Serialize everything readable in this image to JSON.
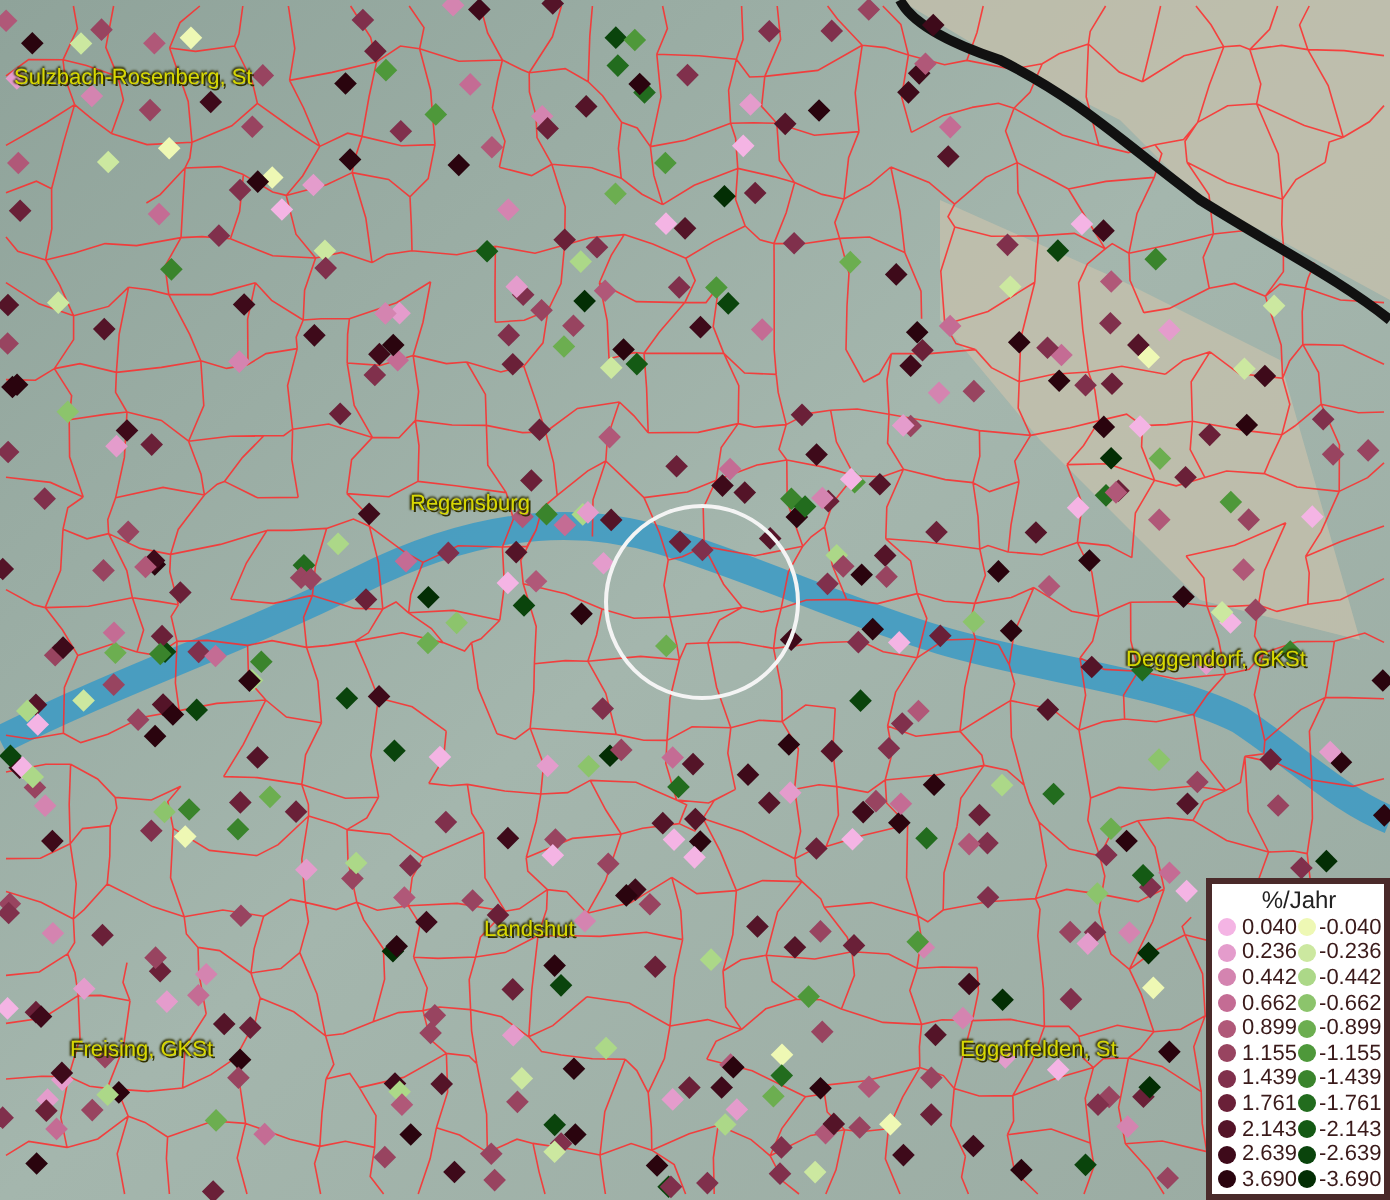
{
  "map": {
    "places": [
      {
        "name": "Sulzbach-Rosenberg, St"
      },
      {
        "name": "Regensburg"
      },
      {
        "name": "Deggendorf, GKSt"
      },
      {
        "name": "Landshut"
      },
      {
        "name": "Freising, GKSt"
      },
      {
        "name": "Eggenfelden, St"
      }
    ]
  },
  "legend": {
    "title": "%/Jahr",
    "positive": [
      {
        "label": "0.040",
        "color": "#f4b4e4"
      },
      {
        "label": "0.236",
        "color": "#e49ccc"
      },
      {
        "label": "0.442",
        "color": "#d484b0"
      },
      {
        "label": "0.662",
        "color": "#c46c94"
      },
      {
        "label": "0.899",
        "color": "#b05878"
      },
      {
        "label": "1.155",
        "color": "#984460"
      },
      {
        "label": "1.439",
        "color": "#80304c"
      },
      {
        "label": "1.761",
        "color": "#6a2038"
      },
      {
        "label": "2.143",
        "color": "#541428"
      },
      {
        "label": "2.639",
        "color": "#3e0a1a"
      },
      {
        "label": "3.690",
        "color": "#2a040e"
      }
    ],
    "negative": [
      {
        "label": "-0.040",
        "color": "#eef8b4"
      },
      {
        "label": "-0.236",
        "color": "#cce8a0"
      },
      {
        "label": "-0.442",
        "color": "#acd888"
      },
      {
        "label": "-0.662",
        "color": "#8cc46c"
      },
      {
        "label": "-0.899",
        "color": "#6cae50"
      },
      {
        "label": "-1.155",
        "color": "#4e983a"
      },
      {
        "label": "-1.439",
        "color": "#3a842c"
      },
      {
        "label": "-1.761",
        "color": "#226c1e"
      },
      {
        "label": "-2.143",
        "color": "#145a14"
      },
      {
        "label": "-2.639",
        "color": "#0a440c"
      },
      {
        "label": "-3.690",
        "color": "#032e04"
      }
    ]
  }
}
